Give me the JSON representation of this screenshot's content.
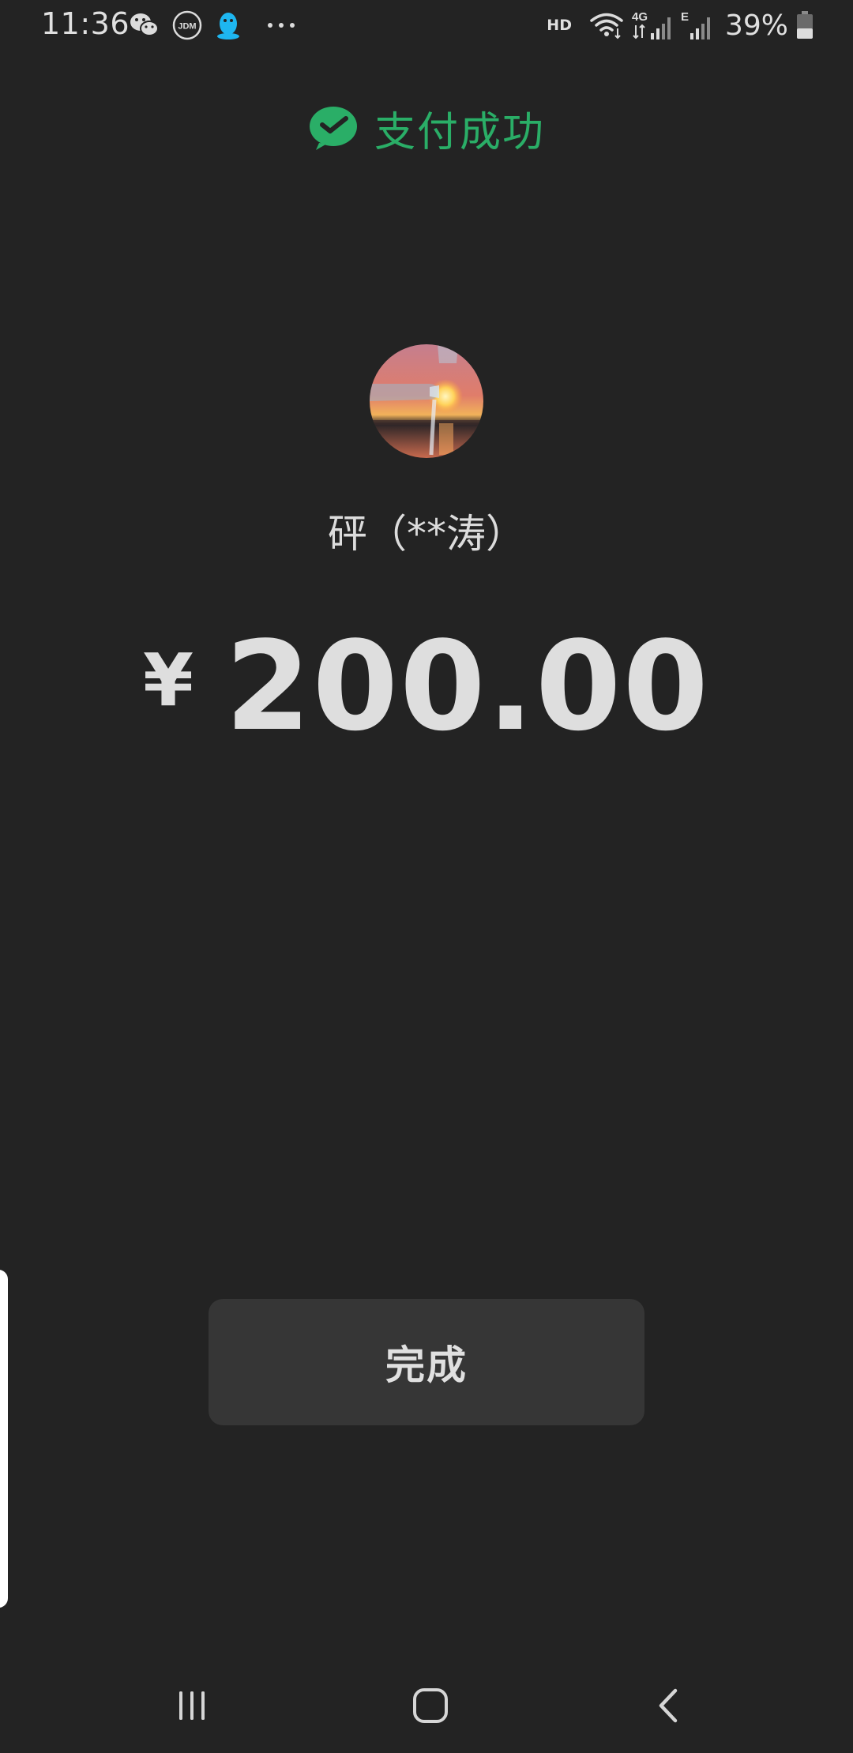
{
  "status_bar": {
    "time": "11:36",
    "notification_icons": [
      "wechat-icon",
      "jdm-icon",
      "qq-icon",
      "more-dots-icon"
    ],
    "jdm_label": "JDM",
    "hd_label": "HD",
    "network_4g_label": "4G",
    "network_e_label": "E",
    "battery_percent": "39%"
  },
  "header": {
    "title": "支付成功",
    "icon": "wechat-pay-check-icon",
    "accent_color": "#2aae67"
  },
  "payee": {
    "name": "砰（**涛）",
    "avatar": "sunset-bottle-avatar"
  },
  "payment": {
    "currency_symbol": "¥",
    "amount": "200.00"
  },
  "actions": {
    "done_label": "完成"
  },
  "navigation": {
    "recents_icon": "recents-icon",
    "home_icon": "home-icon",
    "back_icon": "back-icon"
  },
  "colors": {
    "background": "#232323",
    "button_background": "#363636",
    "text": "#dedede"
  }
}
